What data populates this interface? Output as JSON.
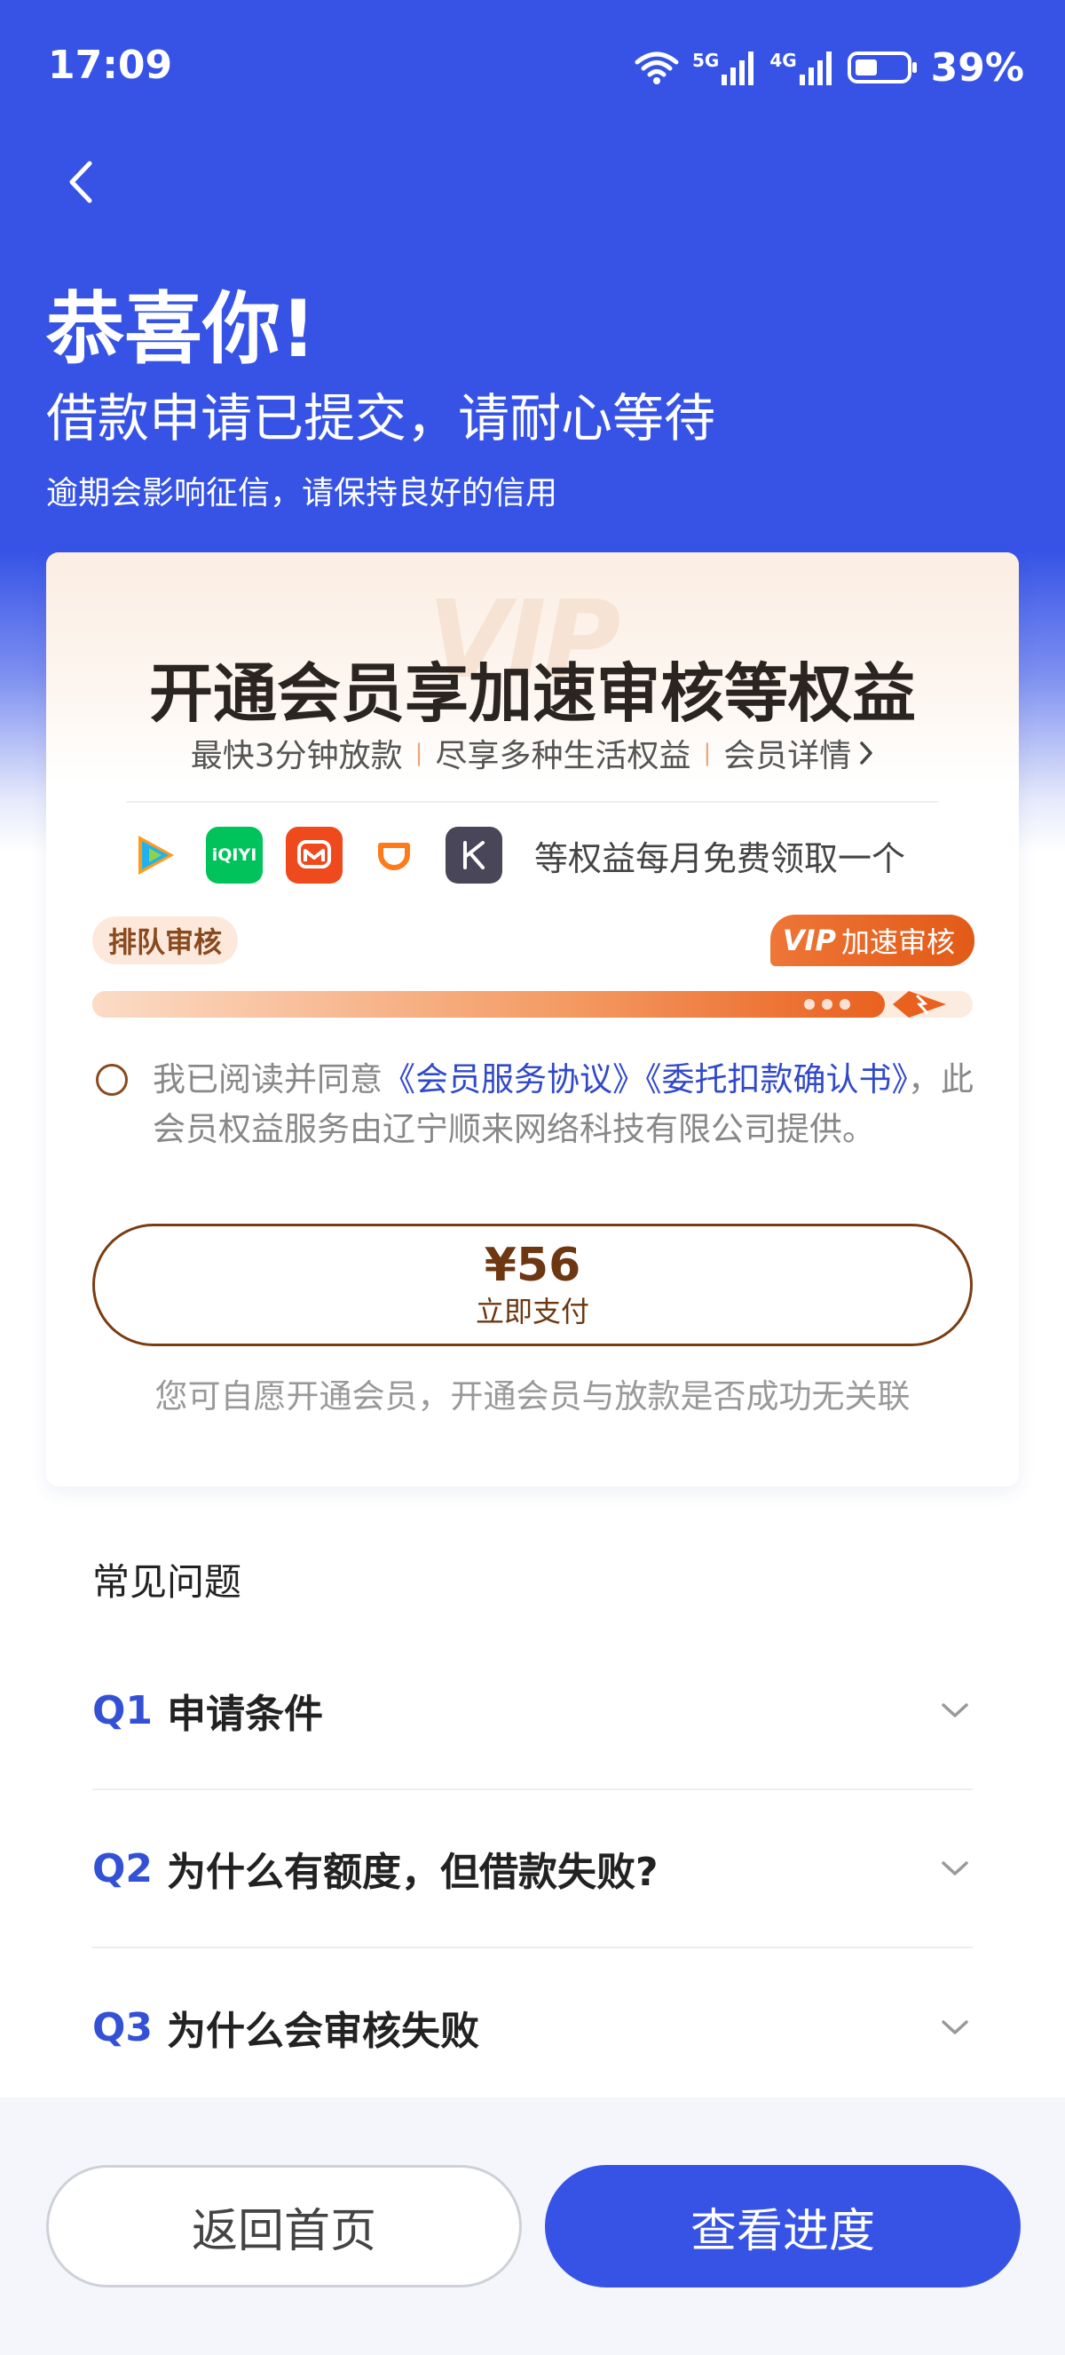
{
  "status_bar": {
    "time": "17:09",
    "network_5g": "5G",
    "network_4g": "4G",
    "battery": "39%"
  },
  "header": {
    "title": "恭喜你!",
    "subtitle": "借款申请已提交，请耐心等待",
    "note": "逾期会影响征信，请保持良好的信用"
  },
  "vip_card": {
    "watermark": "VIP",
    "headline": "开通会员享加速审核等权益",
    "benefit_1": "最快3分钟放款",
    "benefit_2": "尽享多种生活权益",
    "details_link": "会员详情",
    "separator": "|",
    "apps": [
      {
        "name": "tencent-video-icon",
        "color": "#20b2f0"
      },
      {
        "name": "iqiyi-icon",
        "color": "#00c35c",
        "label": "iQIYI"
      },
      {
        "name": "mango-tv-icon",
        "color": "#ef4a1e"
      },
      {
        "name": "didi-icon",
        "color": "#ff7a1a"
      },
      {
        "name": "kuaikan-icon",
        "color": "#4a4659",
        "label": "K"
      }
    ],
    "apps_text": "等权益每月免费领取一个",
    "queue_label": "排队审核",
    "vip_logo": "VIP",
    "vip_label": "加速审核",
    "progress": 0.9,
    "agreement": {
      "prefix": "我已阅读并同意",
      "link_1": "《会员服务协议》",
      "link_2": "《委托扣款确认书》",
      "suffix": "，此会员权益服务由辽宁顺来网络科技有限公司提供。"
    },
    "pay_price": "¥56",
    "pay_label": "立即支付",
    "footnote": "您可自愿开通会员，开通会员与放款是否成功无关联"
  },
  "faq": {
    "title": "常见问题",
    "items": [
      {
        "q": "Q1",
        "text": "申请条件"
      },
      {
        "q": "Q2",
        "text": "为什么有额度，但借款失败?"
      },
      {
        "q": "Q3",
        "text": "为什么会审核失败"
      }
    ]
  },
  "bottom": {
    "home_label": "返回首页",
    "progress_label": "查看进度"
  },
  "colors": {
    "primary": "#3653e6",
    "vip_orange": "#e9611f",
    "vip_brown": "#6d3712"
  }
}
